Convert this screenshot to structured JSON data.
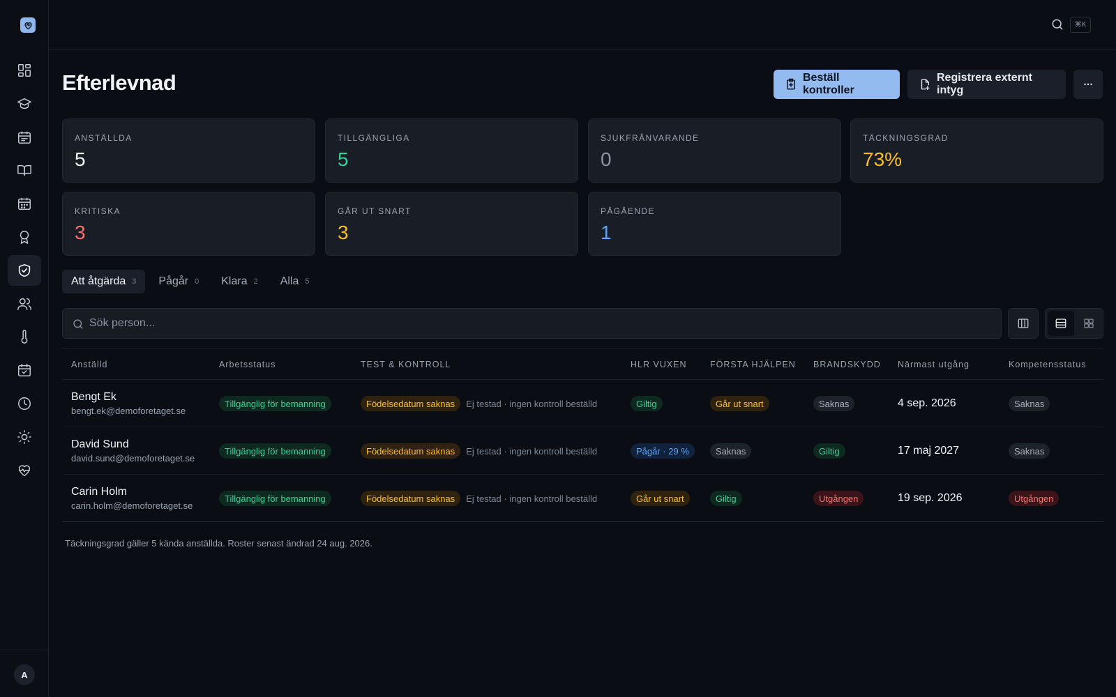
{
  "topbar": {
    "shortcut": "⌘K"
  },
  "user": {
    "initial": "A"
  },
  "page": {
    "title": "Efterlevnad"
  },
  "actions": {
    "primary_label": "Beställ kontroller",
    "secondary_label": "Registrera externt intyg",
    "more_label": "···"
  },
  "stats": [
    {
      "label": "ANSTÄLLDA",
      "value": "5",
      "color": "#f2f4f8"
    },
    {
      "label": "TILLGÄNGLIGA",
      "value": "5",
      "color": "#34d399"
    },
    {
      "label": "SJUKFRÅNVARANDE",
      "value": "0",
      "color": "#8b93a1"
    },
    {
      "label": "TÄCKNINGSGRAD",
      "value": "73%",
      "color": "#fbbf24"
    },
    {
      "label": "KRITISKA",
      "value": "3",
      "color": "#f87171"
    },
    {
      "label": "GÅR UT SNART",
      "value": "3",
      "color": "#fbbf24"
    },
    {
      "label": "PÅGÅENDE",
      "value": "1",
      "color": "#60a5fa"
    }
  ],
  "tabs": [
    {
      "label": "Att åtgärda",
      "count": "3"
    },
    {
      "label": "Pågår",
      "count": "0"
    },
    {
      "label": "Klara",
      "count": "2"
    },
    {
      "label": "Alla",
      "count": "5"
    }
  ],
  "search": {
    "placeholder": "Sök person..."
  },
  "table": {
    "headers": [
      "Anställd",
      "Arbetsstatus",
      "TEST & KONTROLL",
      "HLR VUXEN",
      "FÖRSTA HJÄLPEN",
      "BRANDSKYDD",
      "Närmast utgång",
      "Kompetensstatus"
    ],
    "rows": [
      {
        "name": "Bengt Ek",
        "email": "bengt.ek@demoforetaget.se",
        "work_status": "Tillgänglig för bemanning",
        "test_badge": "Födelsedatum saknas",
        "test_note": "Ej testad · ingen kontroll beställd",
        "hlr": "Giltig",
        "first_aid": "Går ut snart",
        "fire": "Saknas",
        "nearest_expiry": "4 sep. 2026",
        "competence": "Saknas"
      },
      {
        "name": "David Sund",
        "email": "david.sund@demoforetaget.se",
        "work_status": "Tillgänglig för bemanning",
        "test_badge": "Födelsedatum saknas",
        "test_note": "Ej testad · ingen kontroll beställd",
        "hlr": "Pågår · 29 %",
        "first_aid": "Saknas",
        "fire": "Giltig",
        "nearest_expiry": "17 maj 2027",
        "competence": "Saknas"
      },
      {
        "name": "Carin Holm",
        "email": "carin.holm@demoforetaget.se",
        "work_status": "Tillgänglig för bemanning",
        "test_badge": "Födelsedatum saknas",
        "test_note": "Ej testad · ingen kontroll beställd",
        "hlr": "Går ut snart",
        "first_aid": "Giltig",
        "fire": "Utgången",
        "nearest_expiry": "19 sep. 2026",
        "competence": "Utgången"
      }
    ]
  },
  "footer": {
    "note": "Täckningsgrad gäller 5 kända anställda. Roster senast ändrad 24 aug. 2026."
  },
  "colors": {
    "accent": "#94bbef",
    "success": "#34d399",
    "warning": "#fbbf24",
    "danger": "#f87171",
    "info": "#60a5fa"
  }
}
